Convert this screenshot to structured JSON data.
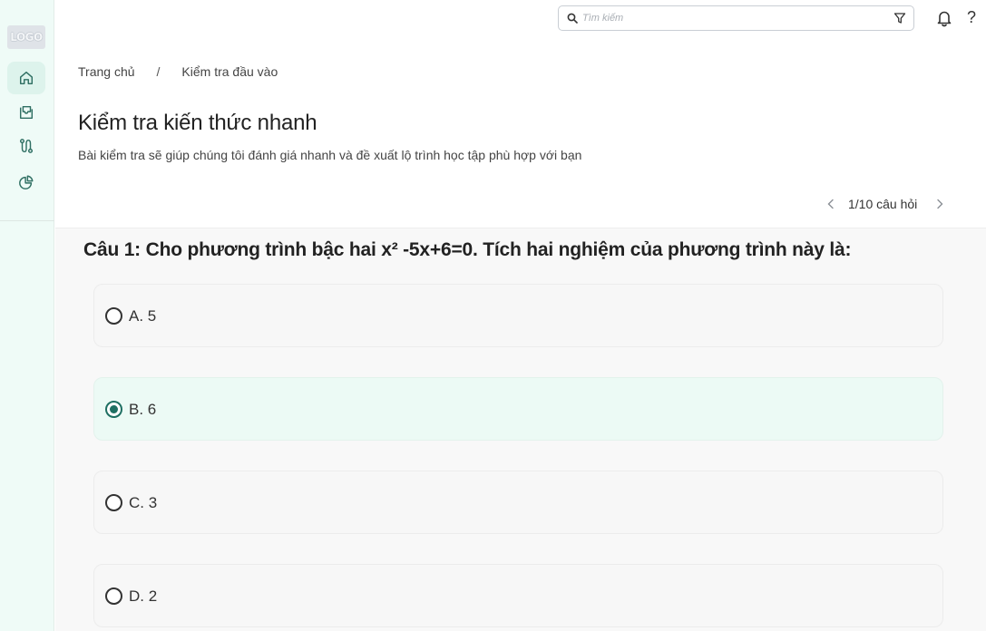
{
  "sidebar": {
    "logo": "LOGO",
    "items": [
      {
        "icon": "home-icon",
        "active": true
      },
      {
        "icon": "course-box-icon",
        "active": false
      },
      {
        "icon": "route-icon",
        "active": false
      },
      {
        "icon": "pie-chart-icon",
        "active": false
      }
    ]
  },
  "topbar": {
    "search_placeholder": "Tìm kiếm",
    "help_label": "?"
  },
  "breadcrumb": {
    "home": "Trang chủ",
    "separator": "/",
    "current": "Kiểm tra đầu vào"
  },
  "page": {
    "title": "Kiểm tra kiến thức nhanh",
    "subtitle": "Bài kiểm tra sẽ giúp chúng tôi đánh giá nhanh và đề xuất lộ trình học tập phù hợp với bạn"
  },
  "pager": {
    "label": "1/10 câu hỏi"
  },
  "question": {
    "text": "Câu 1: Cho phương trình bậc hai x² -5x+6=0. Tích hai nghiệm của phương trình này là:",
    "options": [
      {
        "label": "A. 5",
        "selected": false
      },
      {
        "label": "B. 6",
        "selected": true
      },
      {
        "label": "C. 3",
        "selected": false
      },
      {
        "label": "D. 2",
        "selected": false
      }
    ]
  },
  "colors": {
    "sidebar_bg": "#effbf7",
    "accent": "#1f6f62",
    "selected_bg": "#ecfaf5"
  }
}
